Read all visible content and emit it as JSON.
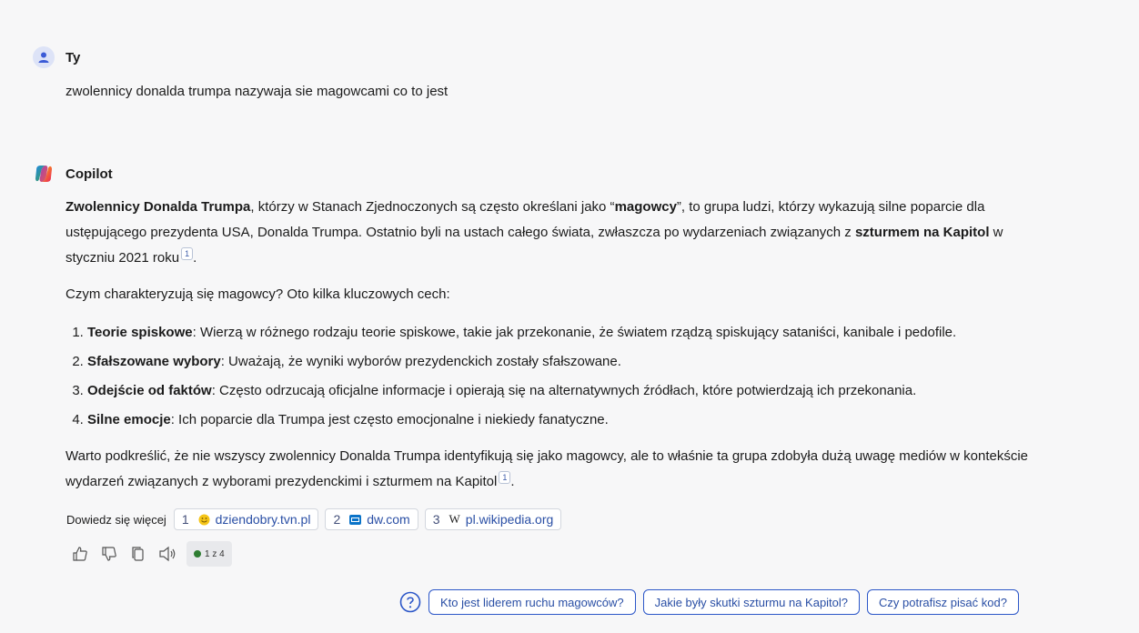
{
  "user_message": {
    "author": "Ty",
    "text": "zwolennicy donalda trumpa nazywaja sie magowcami co to jest"
  },
  "copilot_message": {
    "author": "Copilot",
    "p1": {
      "b1": "Zwolennicy Donalda Trumpa",
      "t1": ", którzy w Stanach Zjednoczonych są często określani jako “",
      "b2": "magowcy",
      "t2": "”, to grupa ludzi, którzy wykazują silne poparcie dla ustępującego prezydenta USA, Donalda Trumpa. Ostatnio byli na ustach całego świata, zwłaszcza po wydarzeniach związanych z ",
      "b3": "szturmem na Kapitol",
      "t3": " w styczniu 2021 roku",
      "cite": "1",
      "end": "."
    },
    "p2": "Czym charakteryzują się magowcy? Oto kilka kluczowych cech:",
    "list": [
      {
        "bold": "Teorie spiskowe",
        "text": ": Wierzą w różnego rodzaju teorie spiskowe, takie jak przekonanie, że światem rządzą spiskujący sataniści, kanibale i pedofile."
      },
      {
        "bold": "Sfałszowane wybory",
        "text": ": Uważają, że wyniki wyborów prezydenckich zostały sfałszowane."
      },
      {
        "bold": "Odejście od faktów",
        "text": ": Często odrzucają oficjalne informacje i opierają się na alternatywnych źródłach, które potwierdzają ich przekonania."
      },
      {
        "bold": "Silne emocje",
        "text": ": Ich poparcie dla Trumpa jest często emocjonalne i niekiedy fanatyczne."
      }
    ],
    "p3": {
      "text": "Warto podkreślić, że nie wszyscy zwolennicy Donalda Trumpa identyfikują się jako magowcy, ale to właśnie ta grupa zdobyła dużą uwagę mediów w kontekście wydarzeń związanych z wyborami prezydenckimi i szturmem na Kapitol",
      "cite": "1",
      "end": "."
    }
  },
  "learn_more": {
    "label": "Dowiedz się więcej",
    "sources": [
      {
        "num": "1",
        "domain": "dziendobry.tvn.pl",
        "icon": "tvn-smiley-icon"
      },
      {
        "num": "2",
        "domain": "dw.com",
        "icon": "dw-logo-icon"
      },
      {
        "num": "3",
        "domain": "pl.wikipedia.org",
        "icon": "wikipedia-w-icon"
      }
    ]
  },
  "response_counter": "1 z 4",
  "suggestions": [
    "Kto jest liderem ruchu magowców?",
    "Jakie były skutki szturmu na Kapitol?",
    "Czy potrafisz pisać kod?"
  ],
  "colors": {
    "background": "#f7f7f8",
    "link": "#2a4fa5",
    "chip_border": "#2b56c8"
  }
}
